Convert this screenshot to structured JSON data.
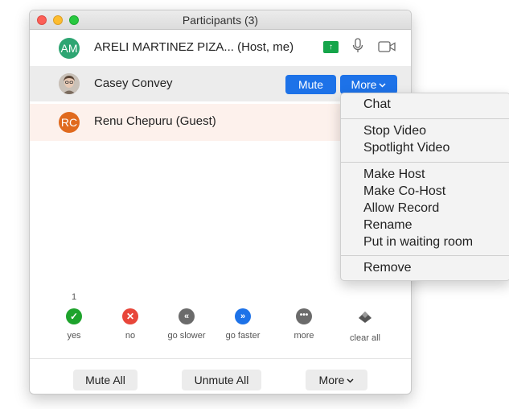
{
  "window": {
    "title": "Participants (3)"
  },
  "participants": [
    {
      "initials": "AM",
      "name": "ARELI MARTINEZ PIZA... (Host, me)",
      "avatar_color": "#2ea572"
    },
    {
      "initials": "",
      "name": "Casey Convey",
      "avatar_type": "photo"
    },
    {
      "initials": "RC",
      "name": "Renu Chepuru (Guest)",
      "avatar_color": "#e06a1e"
    }
  ],
  "row_actions": {
    "mute": "Mute",
    "more": "More"
  },
  "dropdown": {
    "items": [
      "Chat",
      "Stop Video",
      "Spotlight Video",
      "Make Host",
      "Make Co-Host",
      "Allow Record",
      "Rename",
      "Put in waiting room",
      "Remove"
    ]
  },
  "reactions": {
    "count_yes": "1",
    "items": [
      {
        "label": "yes",
        "icon": "check-icon",
        "color": "#1ea32c"
      },
      {
        "label": "no",
        "icon": "x-icon",
        "color": "#e8463a"
      },
      {
        "label": "go slower",
        "icon": "rewind-icon",
        "color": "#6b6b6b"
      },
      {
        "label": "go faster",
        "icon": "fast-forward-icon",
        "color": "#1d72e8"
      },
      {
        "label": "more",
        "icon": "ellipsis-icon",
        "color": "#6b6b6b"
      },
      {
        "label": "clear all",
        "icon": "eraser-icon",
        "color": "#555555"
      }
    ]
  },
  "bottom": {
    "mute_all": "Mute All",
    "unmute_all": "Unmute All",
    "more": "More"
  }
}
